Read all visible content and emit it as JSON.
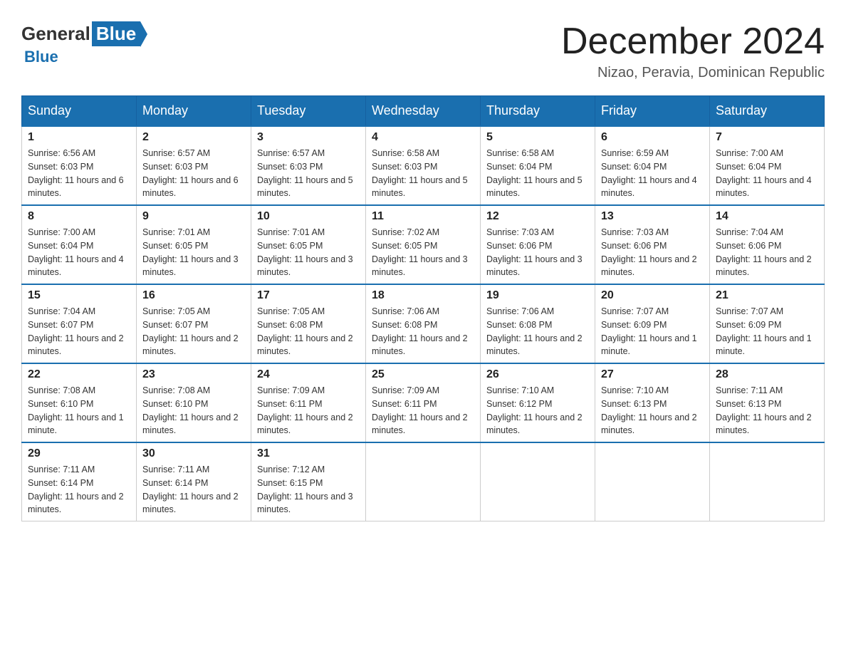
{
  "header": {
    "logo_general": "General",
    "logo_blue": "Blue",
    "title": "December 2024",
    "location": "Nizao, Peravia, Dominican Republic"
  },
  "days_of_week": [
    "Sunday",
    "Monday",
    "Tuesday",
    "Wednesday",
    "Thursday",
    "Friday",
    "Saturday"
  ],
  "weeks": [
    [
      {
        "day": "1",
        "sunrise": "6:56 AM",
        "sunset": "6:03 PM",
        "daylight": "11 hours and 6 minutes."
      },
      {
        "day": "2",
        "sunrise": "6:57 AM",
        "sunset": "6:03 PM",
        "daylight": "11 hours and 6 minutes."
      },
      {
        "day": "3",
        "sunrise": "6:57 AM",
        "sunset": "6:03 PM",
        "daylight": "11 hours and 5 minutes."
      },
      {
        "day": "4",
        "sunrise": "6:58 AM",
        "sunset": "6:03 PM",
        "daylight": "11 hours and 5 minutes."
      },
      {
        "day": "5",
        "sunrise": "6:58 AM",
        "sunset": "6:04 PM",
        "daylight": "11 hours and 5 minutes."
      },
      {
        "day": "6",
        "sunrise": "6:59 AM",
        "sunset": "6:04 PM",
        "daylight": "11 hours and 4 minutes."
      },
      {
        "day": "7",
        "sunrise": "7:00 AM",
        "sunset": "6:04 PM",
        "daylight": "11 hours and 4 minutes."
      }
    ],
    [
      {
        "day": "8",
        "sunrise": "7:00 AM",
        "sunset": "6:04 PM",
        "daylight": "11 hours and 4 minutes."
      },
      {
        "day": "9",
        "sunrise": "7:01 AM",
        "sunset": "6:05 PM",
        "daylight": "11 hours and 3 minutes."
      },
      {
        "day": "10",
        "sunrise": "7:01 AM",
        "sunset": "6:05 PM",
        "daylight": "11 hours and 3 minutes."
      },
      {
        "day": "11",
        "sunrise": "7:02 AM",
        "sunset": "6:05 PM",
        "daylight": "11 hours and 3 minutes."
      },
      {
        "day": "12",
        "sunrise": "7:03 AM",
        "sunset": "6:06 PM",
        "daylight": "11 hours and 3 minutes."
      },
      {
        "day": "13",
        "sunrise": "7:03 AM",
        "sunset": "6:06 PM",
        "daylight": "11 hours and 2 minutes."
      },
      {
        "day": "14",
        "sunrise": "7:04 AM",
        "sunset": "6:06 PM",
        "daylight": "11 hours and 2 minutes."
      }
    ],
    [
      {
        "day": "15",
        "sunrise": "7:04 AM",
        "sunset": "6:07 PM",
        "daylight": "11 hours and 2 minutes."
      },
      {
        "day": "16",
        "sunrise": "7:05 AM",
        "sunset": "6:07 PM",
        "daylight": "11 hours and 2 minutes."
      },
      {
        "day": "17",
        "sunrise": "7:05 AM",
        "sunset": "6:08 PM",
        "daylight": "11 hours and 2 minutes."
      },
      {
        "day": "18",
        "sunrise": "7:06 AM",
        "sunset": "6:08 PM",
        "daylight": "11 hours and 2 minutes."
      },
      {
        "day": "19",
        "sunrise": "7:06 AM",
        "sunset": "6:08 PM",
        "daylight": "11 hours and 2 minutes."
      },
      {
        "day": "20",
        "sunrise": "7:07 AM",
        "sunset": "6:09 PM",
        "daylight": "11 hours and 1 minute."
      },
      {
        "day": "21",
        "sunrise": "7:07 AM",
        "sunset": "6:09 PM",
        "daylight": "11 hours and 1 minute."
      }
    ],
    [
      {
        "day": "22",
        "sunrise": "7:08 AM",
        "sunset": "6:10 PM",
        "daylight": "11 hours and 1 minute."
      },
      {
        "day": "23",
        "sunrise": "7:08 AM",
        "sunset": "6:10 PM",
        "daylight": "11 hours and 2 minutes."
      },
      {
        "day": "24",
        "sunrise": "7:09 AM",
        "sunset": "6:11 PM",
        "daylight": "11 hours and 2 minutes."
      },
      {
        "day": "25",
        "sunrise": "7:09 AM",
        "sunset": "6:11 PM",
        "daylight": "11 hours and 2 minutes."
      },
      {
        "day": "26",
        "sunrise": "7:10 AM",
        "sunset": "6:12 PM",
        "daylight": "11 hours and 2 minutes."
      },
      {
        "day": "27",
        "sunrise": "7:10 AM",
        "sunset": "6:13 PM",
        "daylight": "11 hours and 2 minutes."
      },
      {
        "day": "28",
        "sunrise": "7:11 AM",
        "sunset": "6:13 PM",
        "daylight": "11 hours and 2 minutes."
      }
    ],
    [
      {
        "day": "29",
        "sunrise": "7:11 AM",
        "sunset": "6:14 PM",
        "daylight": "11 hours and 2 minutes."
      },
      {
        "day": "30",
        "sunrise": "7:11 AM",
        "sunset": "6:14 PM",
        "daylight": "11 hours and 2 minutes."
      },
      {
        "day": "31",
        "sunrise": "7:12 AM",
        "sunset": "6:15 PM",
        "daylight": "11 hours and 3 minutes."
      },
      null,
      null,
      null,
      null
    ]
  ]
}
